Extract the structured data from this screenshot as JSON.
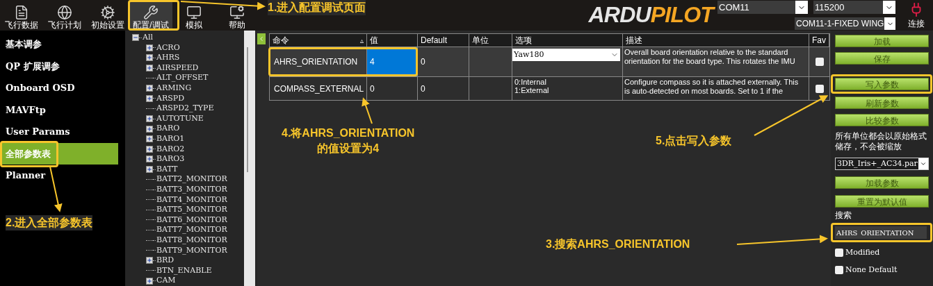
{
  "toolbar": [
    {
      "label": "飞行数据",
      "selected": false
    },
    {
      "label": "飞行计划",
      "selected": false
    },
    {
      "label": "初始设置",
      "selected": false
    },
    {
      "label": "配置/调试",
      "selected": true
    },
    {
      "label": "模拟",
      "selected": false
    },
    {
      "label": "帮助",
      "selected": false
    }
  ],
  "logo": [
    "ARDU",
    "PILOT"
  ],
  "connection": {
    "port": "COM11",
    "baud": "115200",
    "link": "COM11-1-FIXED WING",
    "connect_label": "连接"
  },
  "sidebar": [
    {
      "label": "基本调参",
      "selected": false
    },
    {
      "label": "QP 扩展调参",
      "selected": false
    },
    {
      "label": "Onboard OSD",
      "selected": false
    },
    {
      "label": "MAVFtp",
      "selected": false
    },
    {
      "label": "User Params",
      "selected": false
    },
    {
      "label": "全部参数表",
      "selected": true
    },
    {
      "label": "Planner",
      "selected": false
    }
  ],
  "tree": {
    "label": "All",
    "expanded": true,
    "children": [
      {
        "label": "ACRO",
        "kind": "group"
      },
      {
        "label": "AHRS",
        "kind": "group"
      },
      {
        "label": "AIRSPEED",
        "kind": "group"
      },
      {
        "label": "ALT_OFFSET",
        "kind": "leaf"
      },
      {
        "label": "ARMING",
        "kind": "group"
      },
      {
        "label": "ARSPD",
        "kind": "group"
      },
      {
        "label": "ARSPD2_TYPE",
        "kind": "leaf"
      },
      {
        "label": "AUTOTUNE",
        "kind": "group"
      },
      {
        "label": "BARO",
        "kind": "group"
      },
      {
        "label": "BARO1",
        "kind": "group"
      },
      {
        "label": "BARO2",
        "kind": "group"
      },
      {
        "label": "BARO3",
        "kind": "group"
      },
      {
        "label": "BATT",
        "kind": "group"
      },
      {
        "label": "BATT2_MONITOR",
        "kind": "leaf"
      },
      {
        "label": "BATT3_MONITOR",
        "kind": "leaf"
      },
      {
        "label": "BATT4_MONITOR",
        "kind": "leaf"
      },
      {
        "label": "BATT5_MONITOR",
        "kind": "leaf"
      },
      {
        "label": "BATT6_MONITOR",
        "kind": "leaf"
      },
      {
        "label": "BATT7_MONITOR",
        "kind": "leaf"
      },
      {
        "label": "BATT8_MONITOR",
        "kind": "leaf"
      },
      {
        "label": "BATT9_MONITOR",
        "kind": "leaf"
      },
      {
        "label": "BRD",
        "kind": "group"
      },
      {
        "label": "BTN_ENABLE",
        "kind": "leaf"
      },
      {
        "label": "CAM",
        "kind": "group"
      }
    ]
  },
  "grid": {
    "columns": [
      {
        "label": "命令",
        "sort": "▵"
      },
      {
        "label": "值"
      },
      {
        "label": "Default"
      },
      {
        "label": "单位"
      },
      {
        "label": "选项"
      },
      {
        "label": "描述"
      },
      {
        "label": "Fav"
      }
    ],
    "rows": [
      {
        "command": "AHRS_ORIENTATION",
        "value": "4",
        "value_selected": true,
        "default": "0",
        "options": {
          "kind": "dropdown",
          "value": "Yaw180"
        },
        "description": [
          "Overall board orientation relative to the standard",
          "orientation for the board type. This rotates the IMU"
        ],
        "fav": false
      },
      {
        "command": "COMPASS_EXTERNAL",
        "value": "0",
        "value_selected": false,
        "default": "0",
        "options": {
          "kind": "list",
          "lines": [
            "0:Internal",
            "1:External"
          ]
        },
        "description": [
          "Configure compass so it is attached externally. This",
          "is auto-detected on most boards. Set to 1 if the"
        ],
        "fav": false
      }
    ]
  },
  "actions": [
    "加载",
    "保存",
    "写入参数",
    "刷新参数",
    "比较参数"
  ],
  "note": "所有单位都会以原始格式储存，不会被缩放",
  "file_select": "3DR_Iris+_AC34.par",
  "actions2": [
    "加载参数",
    "重置为默认值"
  ],
  "search": {
    "label": "搜索",
    "value": "AHRS_ORIENTATION"
  },
  "filters": [
    {
      "label": "Modified",
      "checked": false
    },
    {
      "label": "None Default",
      "checked": false
    }
  ],
  "annotations": [
    "1.进入配置调试页面",
    "2.进入全部参数表",
    "3.搜索AHRS_ORIENTATION",
    "4.将AHRS_ORIENTATION\n的值设置为4",
    "5.点击写入参数"
  ]
}
